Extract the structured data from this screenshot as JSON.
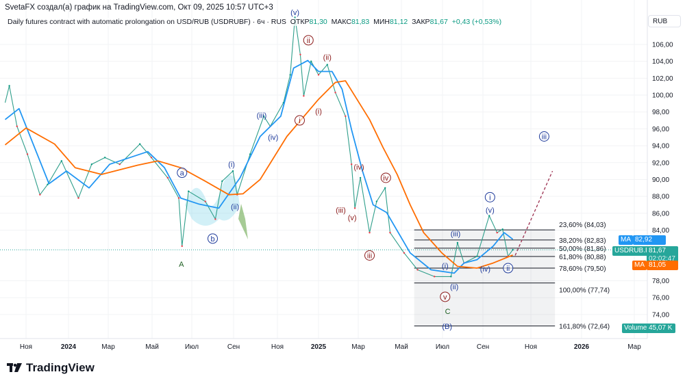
{
  "header": {
    "attribution": "SvetaFX создал(а) график на TradingView.com, Окт 09, 2025 10:57 UTC+3",
    "symbol_desc": "Daily futures contract with automatic prolongation on USD/RUB (USDRUBF) · 6ч · RUS",
    "open_label": "ОТКР",
    "open": "81,30",
    "high_label": "МАКС",
    "high": "81,83",
    "low_label": "МИН",
    "low": "81,12",
    "close_label": "ЗАКР",
    "close": "81,67",
    "change": "+0,43 (+0,53%)"
  },
  "currency_button": "RUB",
  "price_tags": {
    "ma_fast_label": "MA",
    "ma_fast_value": "82,92",
    "symbol_label": "USDRUB.P",
    "symbol_value": "81,67",
    "countdown": "02:02:47",
    "ma_slow_label": "MA",
    "ma_slow_value": "81,05",
    "volume_label": "Volume",
    "volume_value": "45,07 K"
  },
  "footer": {
    "brand": "TradingView"
  },
  "colors": {
    "up": "#089981",
    "down": "#f23645",
    "ma_fast": "#2196f3",
    "ma_slow": "#ff6d00",
    "wave_red": "#8b1a1a",
    "wave_blue": "#1e3a9a",
    "wave_green": "#1b5e20"
  },
  "chart_data": {
    "type": "line",
    "xlabel": "",
    "ylabel": "",
    "ylim": [
      72,
      108
    ],
    "y_ticks": [
      "106,00",
      "104,00",
      "102,00",
      "100,00",
      "98,00",
      "96,00",
      "94,00",
      "92,00",
      "90,00",
      "88,00",
      "86,00",
      "84,00",
      "78,00",
      "76,00",
      "74,00"
    ],
    "x_ticks": [
      {
        "label": "Ноя",
        "date": "2023-11-01"
      },
      {
        "label": "2024",
        "date": "2024-01-01",
        "bold": true
      },
      {
        "label": "Мар",
        "date": "2024-03-01"
      },
      {
        "label": "Май",
        "date": "2024-05-01"
      },
      {
        "label": "Июл",
        "date": "2024-07-01"
      },
      {
        "label": "Сен",
        "date": "2024-09-01"
      },
      {
        "label": "Ноя",
        "date": "2024-11-01"
      },
      {
        "label": "2025",
        "date": "2025-01-01",
        "bold": true
      },
      {
        "label": "Мар",
        "date": "2025-03-01"
      },
      {
        "label": "Май",
        "date": "2025-05-01"
      },
      {
        "label": "Июл",
        "date": "2025-07-01"
      },
      {
        "label": "Сен",
        "date": "2025-09-01"
      },
      {
        "label": "Ноя",
        "date": "2025-11-01"
      },
      {
        "label": "2026",
        "date": "2026-01-01",
        "bold": true
      },
      {
        "label": "Мар",
        "date": "2026-03-01"
      }
    ],
    "grid": true,
    "series": [
      {
        "key": "price",
        "points": [
          [
            "2023-10-02",
            99.1
          ],
          [
            "2023-10-08",
            101.1
          ],
          [
            "2023-10-19",
            96.3
          ],
          [
            "2023-11-03",
            93.0
          ],
          [
            "2023-11-21",
            88.2
          ],
          [
            "2023-12-02",
            89.4
          ],
          [
            "2023-12-22",
            92.2
          ],
          [
            "2024-01-16",
            87.8
          ],
          [
            "2024-02-05",
            91.8
          ],
          [
            "2024-02-25",
            92.6
          ],
          [
            "2024-03-17",
            91.8
          ],
          [
            "2024-04-14",
            94.2
          ],
          [
            "2024-04-30",
            92.6
          ],
          [
            "2024-05-25",
            90.2
          ],
          [
            "2024-06-11",
            87.8
          ],
          [
            "2024-06-16",
            82.1
          ],
          [
            "2024-06-26",
            88.6
          ],
          [
            "2024-07-21",
            87.4
          ],
          [
            "2024-08-05",
            85.3
          ],
          [
            "2024-08-15",
            89.8
          ],
          [
            "2024-08-31",
            91.0
          ],
          [
            "2024-09-06",
            88.2
          ],
          [
            "2024-09-24",
            93.0
          ],
          [
            "2024-10-13",
            97.5
          ],
          [
            "2024-10-22",
            96.3
          ],
          [
            "2024-11-10",
            99.1
          ],
          [
            "2024-11-20",
            102.4
          ],
          [
            "2024-11-27",
            109.2
          ],
          [
            "2024-12-05",
            104.8
          ],
          [
            "2024-12-10",
            99.9
          ],
          [
            "2024-12-21",
            104.0
          ],
          [
            "2025-01-01",
            102.4
          ],
          [
            "2025-01-14",
            103.6
          ],
          [
            "2025-01-26",
            100.3
          ],
          [
            "2025-02-10",
            97.5
          ],
          [
            "2025-02-19",
            91.8
          ],
          [
            "2025-02-24",
            86.6
          ],
          [
            "2025-03-04",
            90.2
          ],
          [
            "2025-03-17",
            83.7
          ],
          [
            "2025-03-27",
            87.4
          ],
          [
            "2025-04-08",
            89.0
          ],
          [
            "2025-04-15",
            83.7
          ],
          [
            "2025-05-05",
            81.3
          ],
          [
            "2025-05-25",
            79.3
          ],
          [
            "2025-06-19",
            78.5
          ],
          [
            "2025-07-14",
            78.5
          ],
          [
            "2025-07-24",
            82.5
          ],
          [
            "2025-08-03",
            80.1
          ],
          [
            "2025-08-23",
            80.9
          ],
          [
            "2025-09-09",
            85.7
          ],
          [
            "2025-09-19",
            83.7
          ],
          [
            "2025-09-26",
            84.1
          ],
          [
            "2025-10-03",
            80.9
          ],
          [
            "2025-10-09",
            81.67
          ]
        ]
      },
      {
        "key": "ma_fast",
        "points": [
          [
            "2023-10-02",
            97.1
          ],
          [
            "2023-10-22",
            98.4
          ],
          [
            "2023-12-04",
            89.5
          ],
          [
            "2023-12-29",
            91.0
          ],
          [
            "2024-02-01",
            89.0
          ],
          [
            "2024-03-03",
            91.8
          ],
          [
            "2024-04-25",
            93.3
          ],
          [
            "2024-05-20",
            91.4
          ],
          [
            "2024-06-14",
            87.8
          ],
          [
            "2024-07-11",
            87.1
          ],
          [
            "2024-08-10",
            86.6
          ],
          [
            "2024-09-10",
            90.2
          ],
          [
            "2024-10-08",
            95.1
          ],
          [
            "2024-11-06",
            97.5
          ],
          [
            "2024-11-25",
            103.2
          ],
          [
            "2024-12-16",
            104.1
          ],
          [
            "2025-01-01",
            102.8
          ],
          [
            "2025-01-21",
            102.8
          ],
          [
            "2025-02-05",
            100.7
          ],
          [
            "2025-02-19",
            95.9
          ],
          [
            "2025-03-07",
            91.0
          ],
          [
            "2025-03-22",
            87.0
          ],
          [
            "2025-04-10",
            86.1
          ],
          [
            "2025-05-14",
            81.3
          ],
          [
            "2025-06-14",
            79.3
          ],
          [
            "2025-07-19",
            78.9
          ],
          [
            "2025-08-03",
            80.1
          ],
          [
            "2025-08-23",
            80.5
          ],
          [
            "2025-09-14",
            82.1
          ],
          [
            "2025-09-28",
            83.7
          ],
          [
            "2025-10-09",
            82.92
          ]
        ]
      },
      {
        "key": "ma_slow",
        "points": [
          [
            "2023-10-02",
            94.1
          ],
          [
            "2023-11-01",
            96.1
          ],
          [
            "2023-12-12",
            94.2
          ],
          [
            "2024-01-11",
            91.4
          ],
          [
            "2024-02-20",
            90.6
          ],
          [
            "2024-04-11",
            91.7
          ],
          [
            "2024-05-10",
            92.2
          ],
          [
            "2024-06-14",
            91.4
          ],
          [
            "2024-07-21",
            89.8
          ],
          [
            "2024-08-25",
            88.2
          ],
          [
            "2024-09-14",
            88.3
          ],
          [
            "2024-10-08",
            90.0
          ],
          [
            "2024-11-15",
            95.1
          ],
          [
            "2025-01-01",
            99.5
          ],
          [
            "2025-01-26",
            101.5
          ],
          [
            "2025-02-10",
            101.7
          ],
          [
            "2025-02-24",
            99.9
          ],
          [
            "2025-03-17",
            97.1
          ],
          [
            "2025-04-05",
            93.8
          ],
          [
            "2025-04-25",
            90.6
          ],
          [
            "2025-05-14",
            87.0
          ],
          [
            "2025-06-03",
            83.7
          ],
          [
            "2025-06-30",
            81.3
          ],
          [
            "2025-07-24",
            79.7
          ],
          [
            "2025-08-23",
            79.5
          ],
          [
            "2025-09-14",
            80.1
          ],
          [
            "2025-10-09",
            81.05
          ]
        ]
      }
    ],
    "last_price": 81.67,
    "fibonacci": {
      "start": "2025-05-20",
      "end": "2025-11-30",
      "levels": [
        {
          "label": "23,60% (84,03)",
          "price": 84.03
        },
        {
          "label": "38,20% (82,83)",
          "price": 82.83
        },
        {
          "label": "50,00% (81,86)",
          "price": 81.86
        },
        {
          "label": "61,80% (80,88)",
          "price": 80.88
        },
        {
          "label": "78,60% (79,50)",
          "price": 79.5
        },
        {
          "label": "100,00% (77,74)",
          "price": 77.74
        },
        {
          "label": "161,80% (72,64)",
          "price": 72.64
        }
      ]
    },
    "projection": {
      "from": [
        "2025-10-12",
        81.0
      ],
      "to": [
        "2025-11-27",
        91.0
      ]
    },
    "annotations": [
      {
        "text": "(v)",
        "date": "2024-11-27",
        "price": 109.8,
        "color": "blue"
      },
      {
        "text": "ii",
        "date": "2024-12-17",
        "price": 106.5,
        "color": "red",
        "circled": true
      },
      {
        "text": "(ii)",
        "date": "2025-01-14",
        "price": 104.5,
        "color": "red"
      },
      {
        "text": "i",
        "date": "2024-12-04",
        "price": 97.0,
        "color": "red",
        "circled": true
      },
      {
        "text": "(i)",
        "date": "2025-01-01",
        "price": 98.1,
        "color": "red"
      },
      {
        "text": "(iii)",
        "date": "2024-10-10",
        "price": 97.6,
        "color": "blue"
      },
      {
        "text": "(iv)",
        "date": "2024-10-26",
        "price": 95.0,
        "color": "blue"
      },
      {
        "text": "(i)",
        "date": "2024-08-29",
        "price": 91.8,
        "color": "blue"
      },
      {
        "text": "(ii)",
        "date": "2024-09-03",
        "price": 86.8,
        "color": "blue"
      },
      {
        "text": "a",
        "date": "2024-06-16",
        "price": 90.8,
        "color": "blue",
        "circled": true
      },
      {
        "text": "b",
        "date": "2024-08-01",
        "price": 83.0,
        "color": "blue",
        "circled": true
      },
      {
        "text": "A",
        "date": "2024-06-15",
        "price": 80.0,
        "color": "green"
      },
      {
        "text": "(iv)",
        "date": "2025-03-02",
        "price": 91.5,
        "color": "red"
      },
      {
        "text": "iv",
        "date": "2025-04-09",
        "price": 90.2,
        "color": "red",
        "circled": true
      },
      {
        "text": "(iii)",
        "date": "2025-02-03",
        "price": 86.4,
        "color": "red"
      },
      {
        "text": "(v)",
        "date": "2025-02-20",
        "price": 85.5,
        "color": "red"
      },
      {
        "text": "iii",
        "date": "2025-03-17",
        "price": 81.0,
        "color": "red",
        "circled": true
      },
      {
        "text": "(iii)",
        "date": "2025-07-21",
        "price": 83.6,
        "color": "blue"
      },
      {
        "text": "(i)",
        "date": "2025-07-05",
        "price": 79.8,
        "color": "blue"
      },
      {
        "text": "(ii)",
        "date": "2025-07-19",
        "price": 77.3,
        "color": "blue"
      },
      {
        "text": "v",
        "date": "2025-07-05",
        "price": 76.1,
        "color": "red",
        "circled": true
      },
      {
        "text": "C",
        "date": "2025-07-09",
        "price": 74.4,
        "color": "green"
      },
      {
        "text": "(B)",
        "date": "2025-07-08",
        "price": 72.6,
        "color": "blue"
      },
      {
        "text": "(iv)",
        "date": "2025-09-04",
        "price": 79.4,
        "color": "blue"
      },
      {
        "text": "ii",
        "date": "2025-10-03",
        "price": 79.5,
        "color": "blue",
        "circled": true
      },
      {
        "text": "i",
        "date": "2025-09-10",
        "price": 87.9,
        "color": "blue",
        "circled": true
      },
      {
        "text": "(v)",
        "date": "2025-09-10",
        "price": 86.4,
        "color": "blue"
      },
      {
        "text": "iii",
        "date": "2025-11-17",
        "price": 95.1,
        "color": "blue",
        "circled": true
      }
    ]
  }
}
